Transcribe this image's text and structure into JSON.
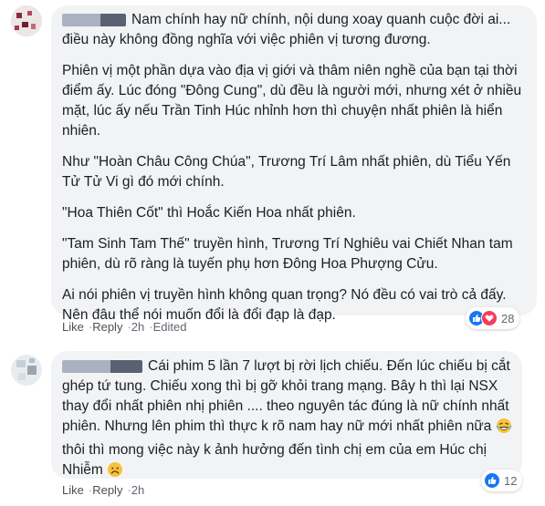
{
  "comments": [
    {
      "author_redacted": true,
      "paragraphs": [
        "Nam chính hay nữ chính, nội dung xoay quanh cuộc đời ai... điều này không đồng nghĩa với việc phiên vị tương đương.",
        "Phiên vị một phần dựa vào địa vị giới và thâm niên nghề của bạn tại thời điểm ấy. Lúc đóng \"Đông Cung\", dù đều là người mới, nhưng xét ở nhiều mặt, lúc ấy nếu Trần Tinh Húc nhỉnh hơn thì chuyện nhất phiên là hiển nhiên.",
        "Như \"Hoàn Châu Công Chúa\", Trương Trí Lâm nhất phiên, dù Tiểu Yến Tử Tử Vi gì đó mới chính.",
        "\"Hoa Thiên Cốt\" thì Hoắc Kiến Hoa nhất phiên.",
        "\"Tam Sinh Tam Thế\" truyền hình, Trương Trí Nghiêu vai Chiết Nhan tam phiên, dù rõ ràng là tuyến phụ hơn Đông Hoa Phượng Cửu.",
        "Ai nói phiên vị truyền hình không quan trọng? Nó đều có vai trò cả đấy. Nên đâu thể nói muốn đổi là đổi đạp là đạp."
      ],
      "actions": {
        "like": "Like",
        "reply": "Reply",
        "time": "2h",
        "edited": "Edited"
      },
      "reaction_count": "28",
      "reactions": [
        "like-icon",
        "love-icon"
      ]
    },
    {
      "author_redacted": true,
      "paragraphs": [
        "Cái phim 5 lần 7 lượt bị rời lịch chiếu. Đến lúc chiếu bị cắt ghép tứ tung. Chiếu xong thì bị gỡ khỏi trang mạng. Bây h thì lại NSX thay đổi nhất phiên nhị phiên .... theo nguyên tác đúng là nữ chính nhất phiên. Nhưng lên phim thì thực k rõ nam hay nữ mới nhất phiên nữa",
        "thôi thì mong việc này k ảnh hưởng đến tình chị em của em Húc chị Nhiễm"
      ],
      "actions": {
        "like": "Like",
        "reply": "Reply",
        "time": "2h"
      },
      "reaction_count": "12",
      "reactions": [
        "like-icon"
      ]
    }
  ],
  "colors": {
    "bubble": "#f2f3f5",
    "like": "#1877f2",
    "love": "#f33e58",
    "meta": "#606770"
  }
}
